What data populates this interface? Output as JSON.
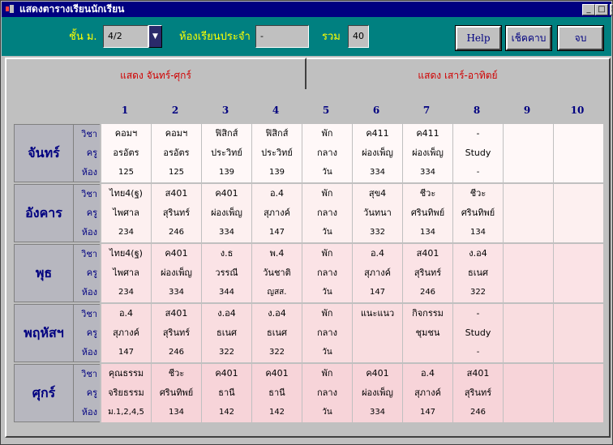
{
  "window": {
    "title": "แสดงตารางเรียนนักเรียน",
    "controls": {
      "minimize": "_",
      "maximize": "□",
      "close": "×"
    }
  },
  "toolbar": {
    "grade_label": "ชั้น ม.",
    "grade_value": "4/2",
    "homeroom_label": "ห้องเรียนประจำ",
    "homeroom_value": "-",
    "total_label": "รวม",
    "total_value": "40",
    "help_label": "Help",
    "check_label": "เช็คคาบ",
    "exit_label": "จบ"
  },
  "tabs": [
    {
      "label": "แสดง จันทร์-ศุกร์",
      "active": true
    },
    {
      "label": "แสดง เสาร์-อาทิตย์",
      "active": false
    }
  ],
  "periods": [
    "1",
    "2",
    "3",
    "4",
    "5",
    "6",
    "7",
    "8",
    "9",
    "10"
  ],
  "sublabels": [
    "วิชา",
    "ครู",
    "ห้อง"
  ],
  "days": [
    {
      "name": "จันทร์",
      "cells": [
        [
          "คอมฯ",
          "อรอัตร",
          "125"
        ],
        [
          "คอมฯ",
          "อรอัตร",
          "125"
        ],
        [
          "ฟิสิกส์",
          "ประวิทย์",
          "139"
        ],
        [
          "ฟิสิกส์",
          "ประวิทย์",
          "139"
        ],
        [
          "พัก",
          "กลาง",
          "วัน"
        ],
        [
          "ค411",
          "ผ่องเพ็ญ",
          "334"
        ],
        [
          "ค411",
          "ผ่องเพ็ญ",
          "334"
        ],
        [
          "-",
          "Study",
          "-"
        ],
        [
          "",
          "",
          ""
        ],
        [
          "",
          "",
          ""
        ]
      ]
    },
    {
      "name": "อังคาร",
      "cells": [
        [
          "ไทย4(ฐ)",
          "ไพศาล",
          "234"
        ],
        [
          "ส401",
          "สุรินทร์",
          "246"
        ],
        [
          "ค401",
          "ผ่องเพ็ญ",
          "334"
        ],
        [
          "อ.4",
          "สุภางค์",
          "147"
        ],
        [
          "พัก",
          "กลาง",
          "วัน"
        ],
        [
          "สุข4",
          "วันทนา",
          "332"
        ],
        [
          "ชีวะ",
          "ศรินทิพย์",
          "134"
        ],
        [
          "ชีวะ",
          "ศรินทิพย์",
          "134"
        ],
        [
          "",
          "",
          ""
        ],
        [
          "",
          "",
          ""
        ]
      ]
    },
    {
      "name": "พุธ",
      "cells": [
        [
          "ไทย4(ฐ)",
          "ไพศาล",
          "234"
        ],
        [
          "ค401",
          "ผ่องเพ็ญ",
          "334"
        ],
        [
          "ง.ธ",
          "วรรณี",
          "344"
        ],
        [
          "พ.4",
          "วันชาติ",
          "ญสส."
        ],
        [
          "พัก",
          "กลาง",
          "วัน"
        ],
        [
          "อ.4",
          "สุภางค์",
          "147"
        ],
        [
          "ส401",
          "สุรินทร์",
          "246"
        ],
        [
          "ง.อ4",
          "ธเนศ",
          "322"
        ],
        [
          "",
          "",
          ""
        ],
        [
          "",
          "",
          ""
        ]
      ]
    },
    {
      "name": "พฤหัสฯ",
      "cells": [
        [
          "อ.4",
          "สุภางค์",
          "147"
        ],
        [
          "ส401",
          "สุรินทร์",
          "246"
        ],
        [
          "ง.อ4",
          "ธเนศ",
          "322"
        ],
        [
          "ง.อ4",
          "ธเนศ",
          "322"
        ],
        [
          "พัก",
          "กลาง",
          "วัน"
        ],
        [
          "แนะแนว",
          "",
          ""
        ],
        [
          "กิจกรรม",
          "ชุมชน",
          ""
        ],
        [
          "-",
          "Study",
          "-"
        ],
        [
          "",
          "",
          ""
        ],
        [
          "",
          "",
          ""
        ]
      ]
    },
    {
      "name": "ศุกร์",
      "cells": [
        [
          "คุณธรรม",
          "จริยธรรม",
          "ม.1,2,4,5"
        ],
        [
          "ชีวะ",
          "ศรินทิพย์",
          "134"
        ],
        [
          "ค401",
          "ธานี",
          "142"
        ],
        [
          "ค401",
          "ธานี",
          "142"
        ],
        [
          "พัก",
          "กลาง",
          "วัน"
        ],
        [
          "ค401",
          "ผ่องเพ็ญ",
          "334"
        ],
        [
          "อ.4",
          "สุภางค์",
          "147"
        ],
        [
          "ส401",
          "สุรินทร์",
          "246"
        ],
        [
          "",
          "",
          ""
        ],
        [
          "",
          "",
          ""
        ]
      ]
    }
  ]
}
